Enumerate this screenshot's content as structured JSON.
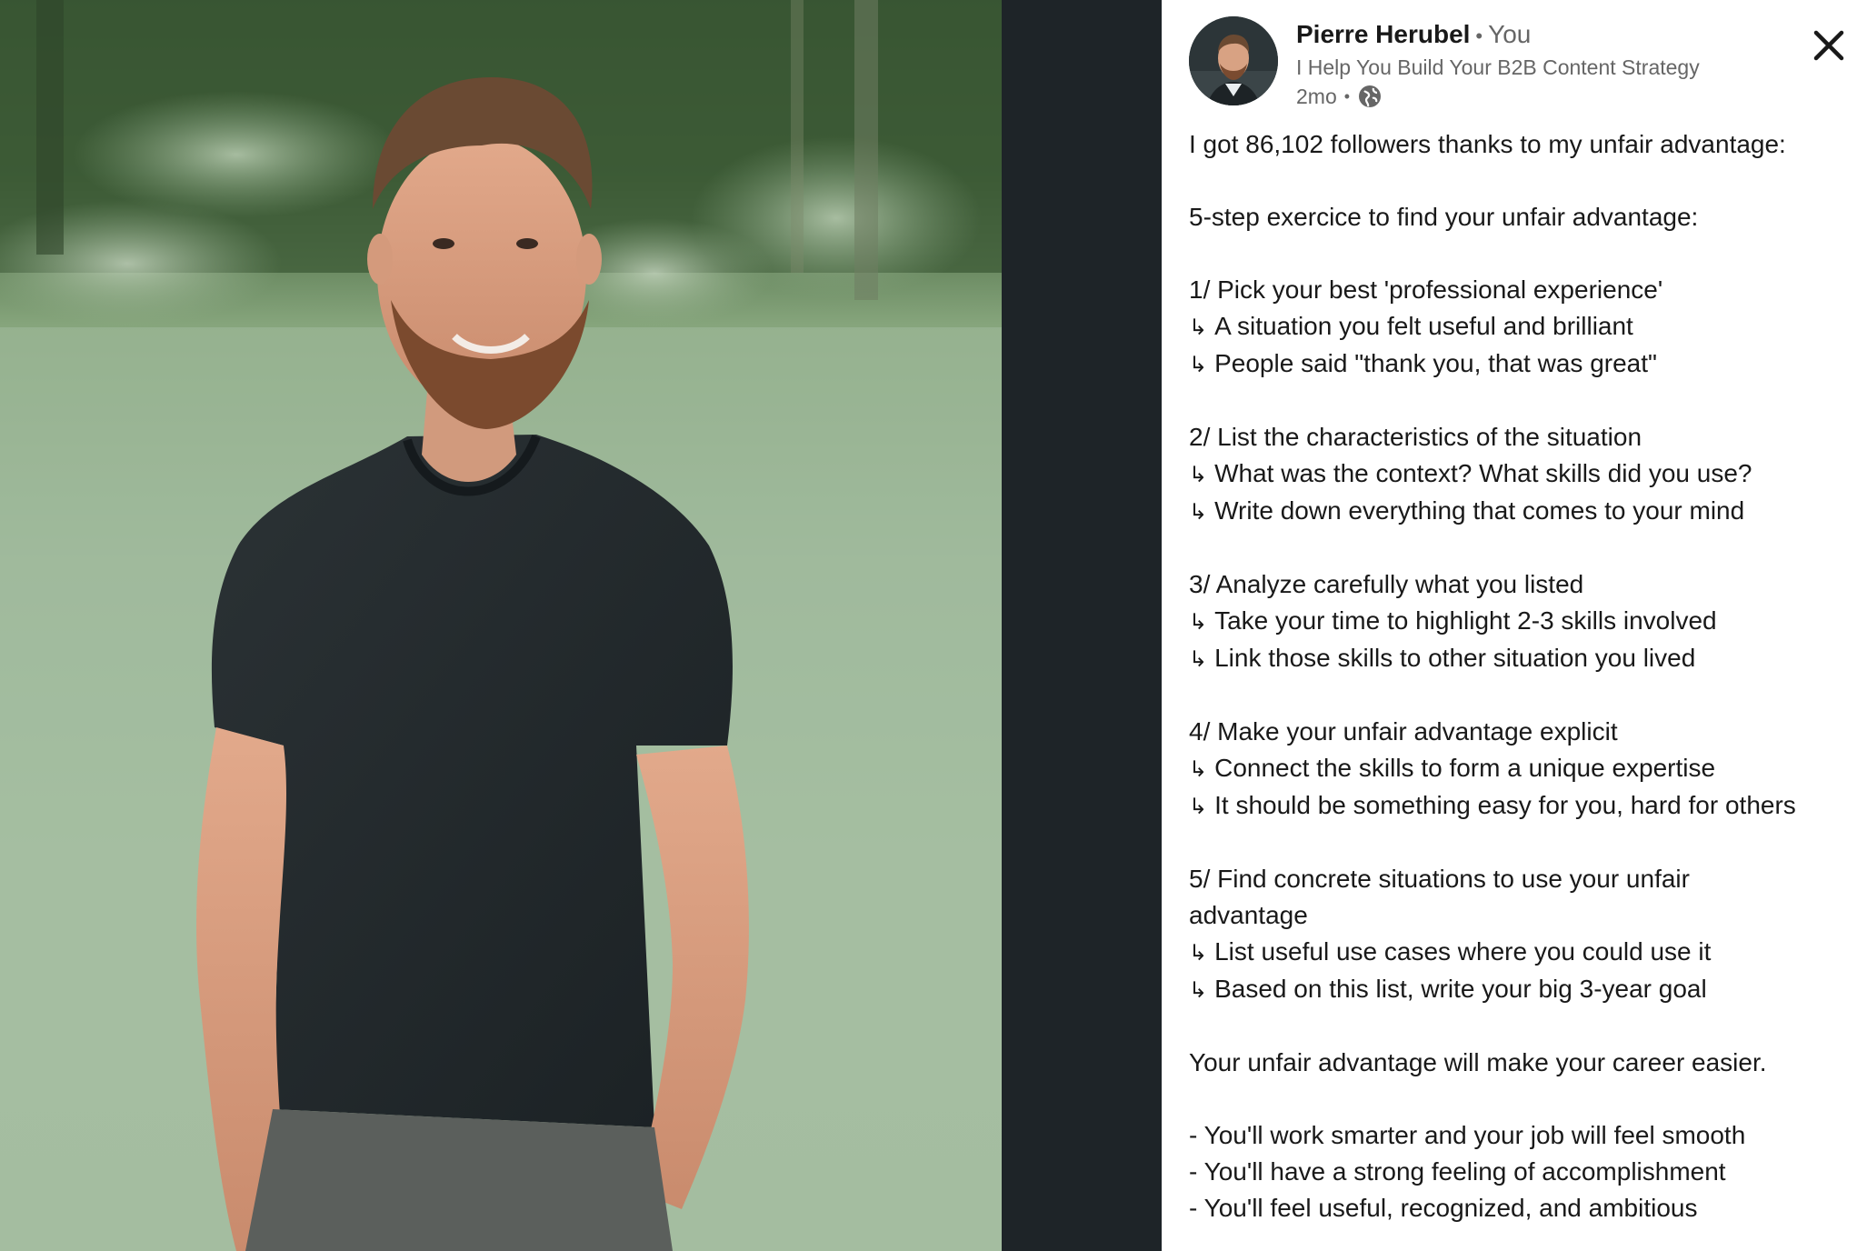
{
  "author": {
    "name": "Pierre Herubel",
    "relation": "You",
    "headline": "I Help You Build Your B2B Content Strategy",
    "time": "2mo",
    "visibility_icon": "globe-icon",
    "avatar_icon": "profile-photo"
  },
  "controls": {
    "close_icon": "close-icon"
  },
  "photo": {
    "subject": "post-image"
  },
  "post": {
    "lines": [
      {
        "text": "I got 86,102 followers thanks to my unfair advantage:"
      },
      {
        "text": ""
      },
      {
        "text": "5-step exercice to find your unfair advantage:"
      },
      {
        "text": ""
      },
      {
        "text": "1/ Pick your best 'professional experience'"
      },
      {
        "arrow": "↳",
        "text": "A situation you felt useful and brilliant"
      },
      {
        "arrow": "↳",
        "text": "People said \"thank you, that was great\""
      },
      {
        "text": ""
      },
      {
        "text": "2/ List the characteristics of the situation"
      },
      {
        "arrow": "↳",
        "text": "What was the context? What skills did you use?"
      },
      {
        "arrow": "↳",
        "text": "Write down everything that comes to your mind"
      },
      {
        "text": ""
      },
      {
        "text": "3/ Analyze carefully what you listed"
      },
      {
        "arrow": "↳",
        "text": "Take your time to highlight 2-3 skills involved"
      },
      {
        "arrow": "↳",
        "text": "Link those skills to other situation you lived"
      },
      {
        "text": ""
      },
      {
        "text": "4/ Make your unfair advantage explicit"
      },
      {
        "arrow": "↳",
        "text": "Connect the skills to form a unique expertise"
      },
      {
        "arrow": "↳",
        "text": "It should be something easy for you, hard for others"
      },
      {
        "text": ""
      },
      {
        "text": "5/ Find concrete situations to use your unfair"
      },
      {
        "text": "advantage"
      },
      {
        "arrow": "↳",
        "text": "List useful use cases where you could use it"
      },
      {
        "arrow": "↳",
        "text": "Based on this list, write your big 3-year goal"
      },
      {
        "text": ""
      },
      {
        "text": "Your unfair advantage will make your career easier."
      },
      {
        "text": ""
      },
      {
        "text": "- You'll work smarter and your job will feel smooth"
      },
      {
        "text": "- You'll have a strong feeling of accomplishment"
      },
      {
        "text": "- You'll feel useful, recognized, and ambitious"
      }
    ]
  },
  "colors": {
    "pane_bg": "#ffffff",
    "text_primary": "#191919",
    "text_secondary": "#666666",
    "gutter": "#1e2428"
  }
}
